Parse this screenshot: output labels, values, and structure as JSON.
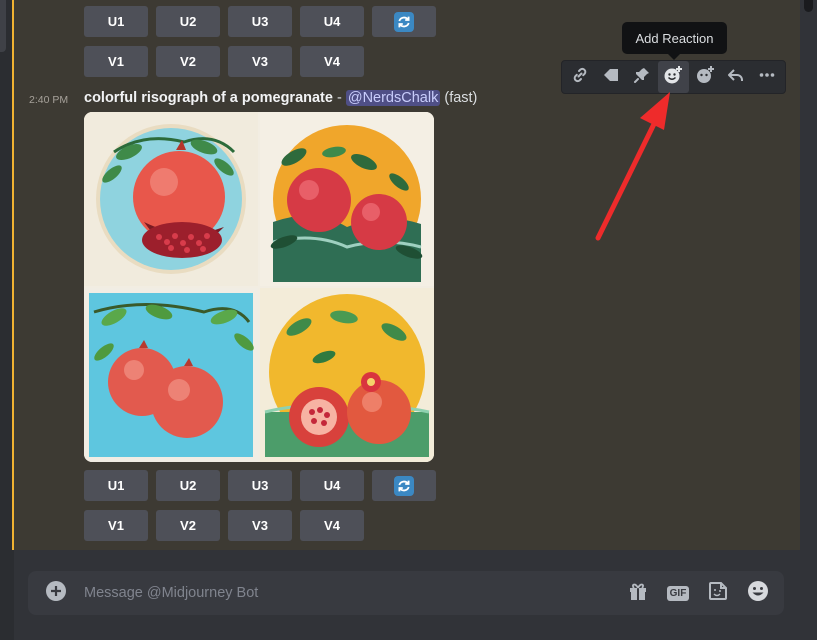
{
  "top_buttons": {
    "upscale": [
      "U1",
      "U2",
      "U3",
      "U4"
    ],
    "variation": [
      "V1",
      "V2",
      "V3",
      "V4"
    ]
  },
  "message": {
    "timestamp": "2:40 PM",
    "prompt": "colorful risograph of a pomegranate",
    "separator": " - ",
    "mention": "@NerdsChalk",
    "speed": "(fast)"
  },
  "bottom_buttons": {
    "upscale": [
      "U1",
      "U2",
      "U3",
      "U4"
    ],
    "variation": [
      "V1",
      "V2",
      "V3",
      "V4"
    ]
  },
  "hover_toolbar": {
    "tooltip": "Add Reaction",
    "icons": [
      "link-icon",
      "tag-icon",
      "pin-icon",
      "add-reaction-icon",
      "app-reaction-icon",
      "reply-icon",
      "more-icon"
    ]
  },
  "composer": {
    "placeholder": "Message @Midjourney Bot",
    "icons": [
      "add-icon",
      "gift-icon",
      "gif-icon",
      "sticker-icon",
      "emoji-icon"
    ],
    "gif_label": "GIF"
  },
  "colors": {
    "highlight": "#f0b232",
    "button": "#4e5058",
    "refresh": "#3b88c3",
    "arrow": "#ee2b2b",
    "mention_bg": "#4f4f86"
  }
}
